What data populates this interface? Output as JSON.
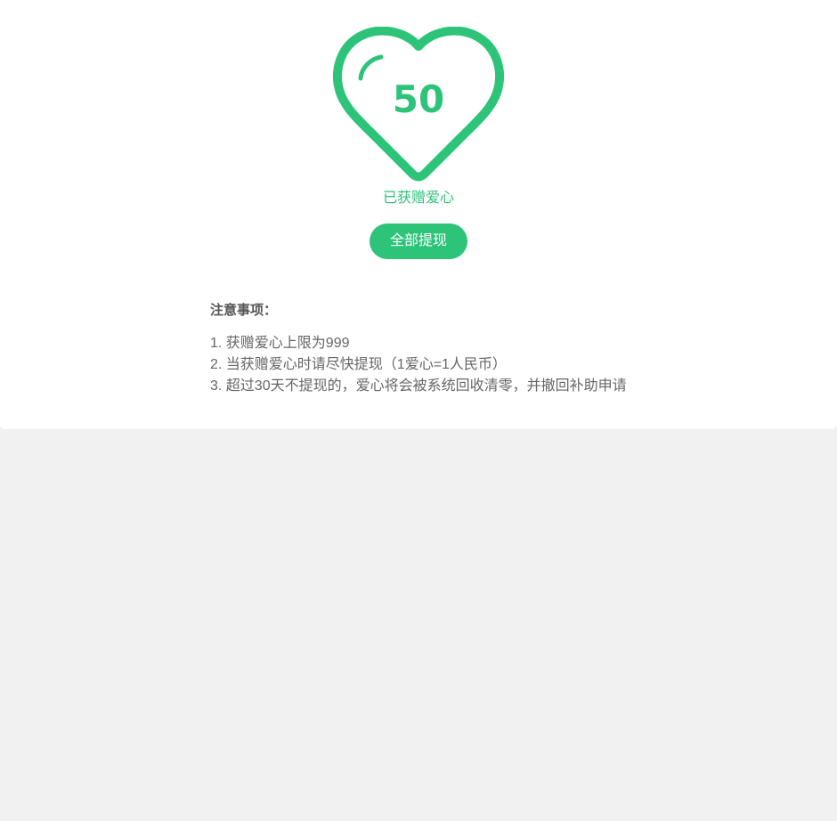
{
  "heart": {
    "count": "50",
    "label": "已获赠爱心",
    "color": "#2dc47a"
  },
  "actions": {
    "withdraw_all_label": "全部提现"
  },
  "notes": {
    "title": "注意事项：",
    "items": [
      "1. 获赠爱心上限为999",
      "2. 当获赠爱心时请尽快提现（1爱心=1人民币）",
      "3. 超过30天不提现的，爱心将会被系统回收清零，并撤回补助申请"
    ]
  }
}
